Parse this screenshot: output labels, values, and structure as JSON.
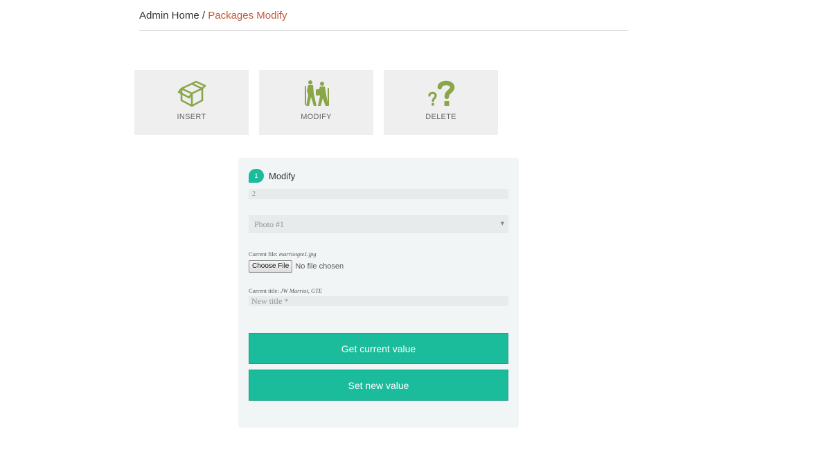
{
  "breadcrumb": {
    "home": "Admin Home",
    "separator": " / ",
    "current": "Packages Modify"
  },
  "tiles": [
    {
      "label": "INSERT",
      "icon": "box-icon"
    },
    {
      "label": "MODIFY",
      "icon": "hikers-icon"
    },
    {
      "label": "DELETE",
      "icon": "question-marks-icon"
    }
  ],
  "form": {
    "step_number": "1",
    "step_title": "Modify",
    "id_value": "2",
    "photo_select": "Photo #1",
    "current_file_label": "Current file:",
    "current_file_value": "marriotgte1.jpg",
    "file_button": "Choose File",
    "file_status": "No file chosen",
    "current_title_label": "Current title:",
    "current_title_value": "JW Marriot, GTE",
    "new_title_placeholder": "New title *",
    "get_button": "Get current value",
    "set_button": "Set new value"
  },
  "colors": {
    "accent": "#1abc9c",
    "icon": "#8aa648",
    "breadcrumb_current": "#c0583a",
    "panel_bg": "#f2f5f6"
  }
}
